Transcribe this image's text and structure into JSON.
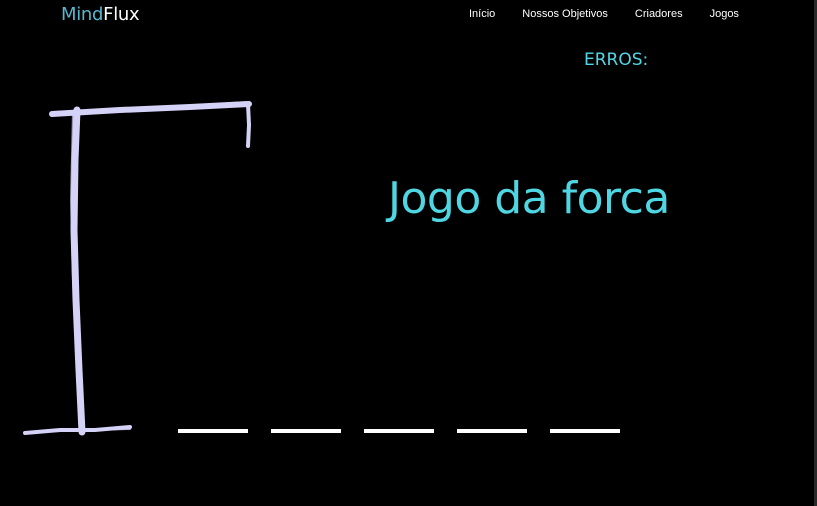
{
  "header": {
    "logo_part1": "Mind",
    "logo_part2": "Flux",
    "nav": [
      {
        "label": "Início"
      },
      {
        "label": "Nossos Objetivos"
      },
      {
        "label": "Criadores"
      },
      {
        "label": "Jogos"
      }
    ]
  },
  "game": {
    "errors_label": "ERROS:",
    "title": "Jogo da forca",
    "word_length": 5
  },
  "colors": {
    "background": "#000000",
    "accent": "#4fd6e3",
    "logo_accent": "#55b8cf",
    "gallows": "#d4d2f7",
    "slot": "#ffffff"
  }
}
